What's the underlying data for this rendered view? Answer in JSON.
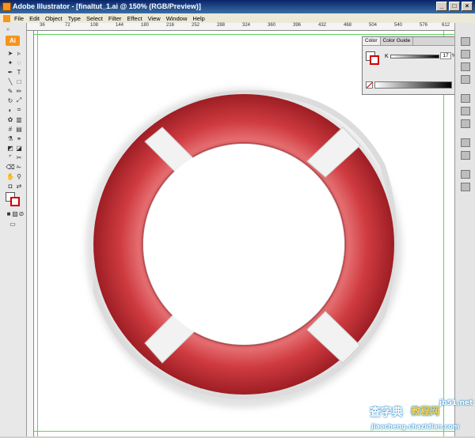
{
  "window": {
    "title": "Adobe Illustrator - [finaltut_1.ai @ 150% (RGB/Preview)]"
  },
  "menu": [
    "File",
    "Edit",
    "Object",
    "Type",
    "Select",
    "Filter",
    "Effect",
    "View",
    "Window",
    "Help"
  ],
  "toolbox": {
    "logo": "Ai"
  },
  "ruler_ticks": [
    "36",
    "72",
    "108",
    "144",
    "180",
    "216",
    "252",
    "288",
    "324",
    "360",
    "396",
    "432",
    "468",
    "504",
    "540",
    "576",
    "612"
  ],
  "color_panel": {
    "tabs": [
      "Color",
      "Color Guide"
    ],
    "channel_label": "K",
    "channel_value": "17",
    "unit": "%"
  },
  "colors": {
    "ring_red": "#c8363a",
    "ring_light": "#e06a6c",
    "strap": "#f2f2f2",
    "guide": "#5fd35f",
    "accent": "#f7941d"
  },
  "watermark": {
    "line1": "查字典",
    "line2": "教程网",
    "domain": "jb51.net",
    "sub": "jiaocheng.chazidian.com"
  }
}
